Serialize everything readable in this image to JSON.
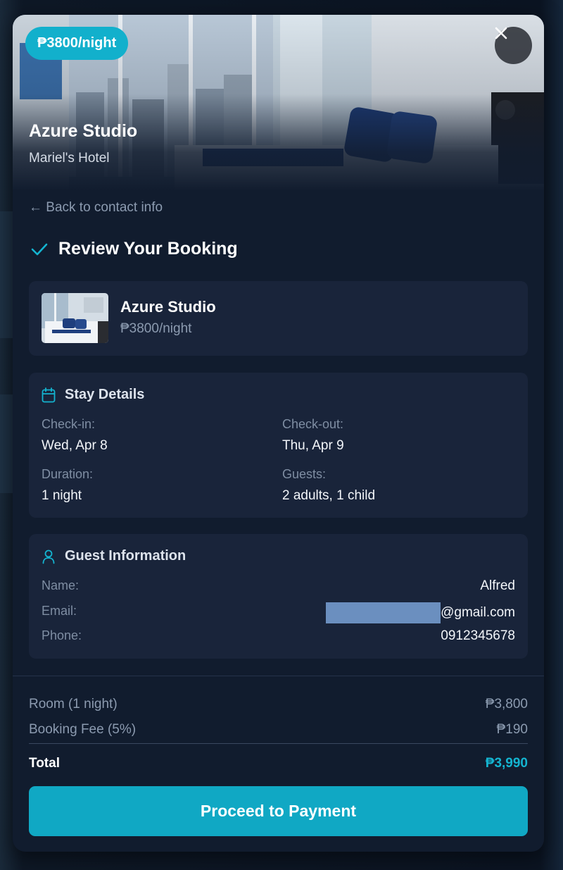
{
  "hero": {
    "price_badge": "₱3800/night",
    "title": "Azure Studio",
    "subtitle": "Mariel's Hotel",
    "close_icon": "close-icon"
  },
  "nav": {
    "back_link": "← Back to contact info"
  },
  "review": {
    "title": "Review Your Booking",
    "icon": "check-icon"
  },
  "room": {
    "name": "Azure Studio",
    "price": "₱3800/night"
  },
  "stay": {
    "heading": "Stay Details",
    "icon": "calendar-icon",
    "checkin_label": "Check-in:",
    "checkin_value": "Wed, Apr 8",
    "checkout_label": "Check-out:",
    "checkout_value": "Thu, Apr 9",
    "duration_label": "Duration:",
    "duration_value": "1 night",
    "guests_label": "Guests:",
    "guests_value": "2 adults, 1 child"
  },
  "guest": {
    "heading": "Guest Information",
    "icon": "user-icon",
    "name_label": "Name:",
    "name_value": "Alfred",
    "email_label": "Email:",
    "email_value": "@gmail.com",
    "phone_label": "Phone:",
    "phone_value": "0912345678"
  },
  "summary": {
    "room_label": "Room (1 night)",
    "room_value": "₱3,800",
    "fee_label": "Booking Fee (5%)",
    "fee_value": "₱190",
    "total_label": "Total",
    "total_value": "₱3,990"
  },
  "actions": {
    "pay_button": "Proceed to Payment"
  },
  "colors": {
    "accent": "#12b0cc",
    "card": "#19243a",
    "panel": "#111c2e"
  }
}
